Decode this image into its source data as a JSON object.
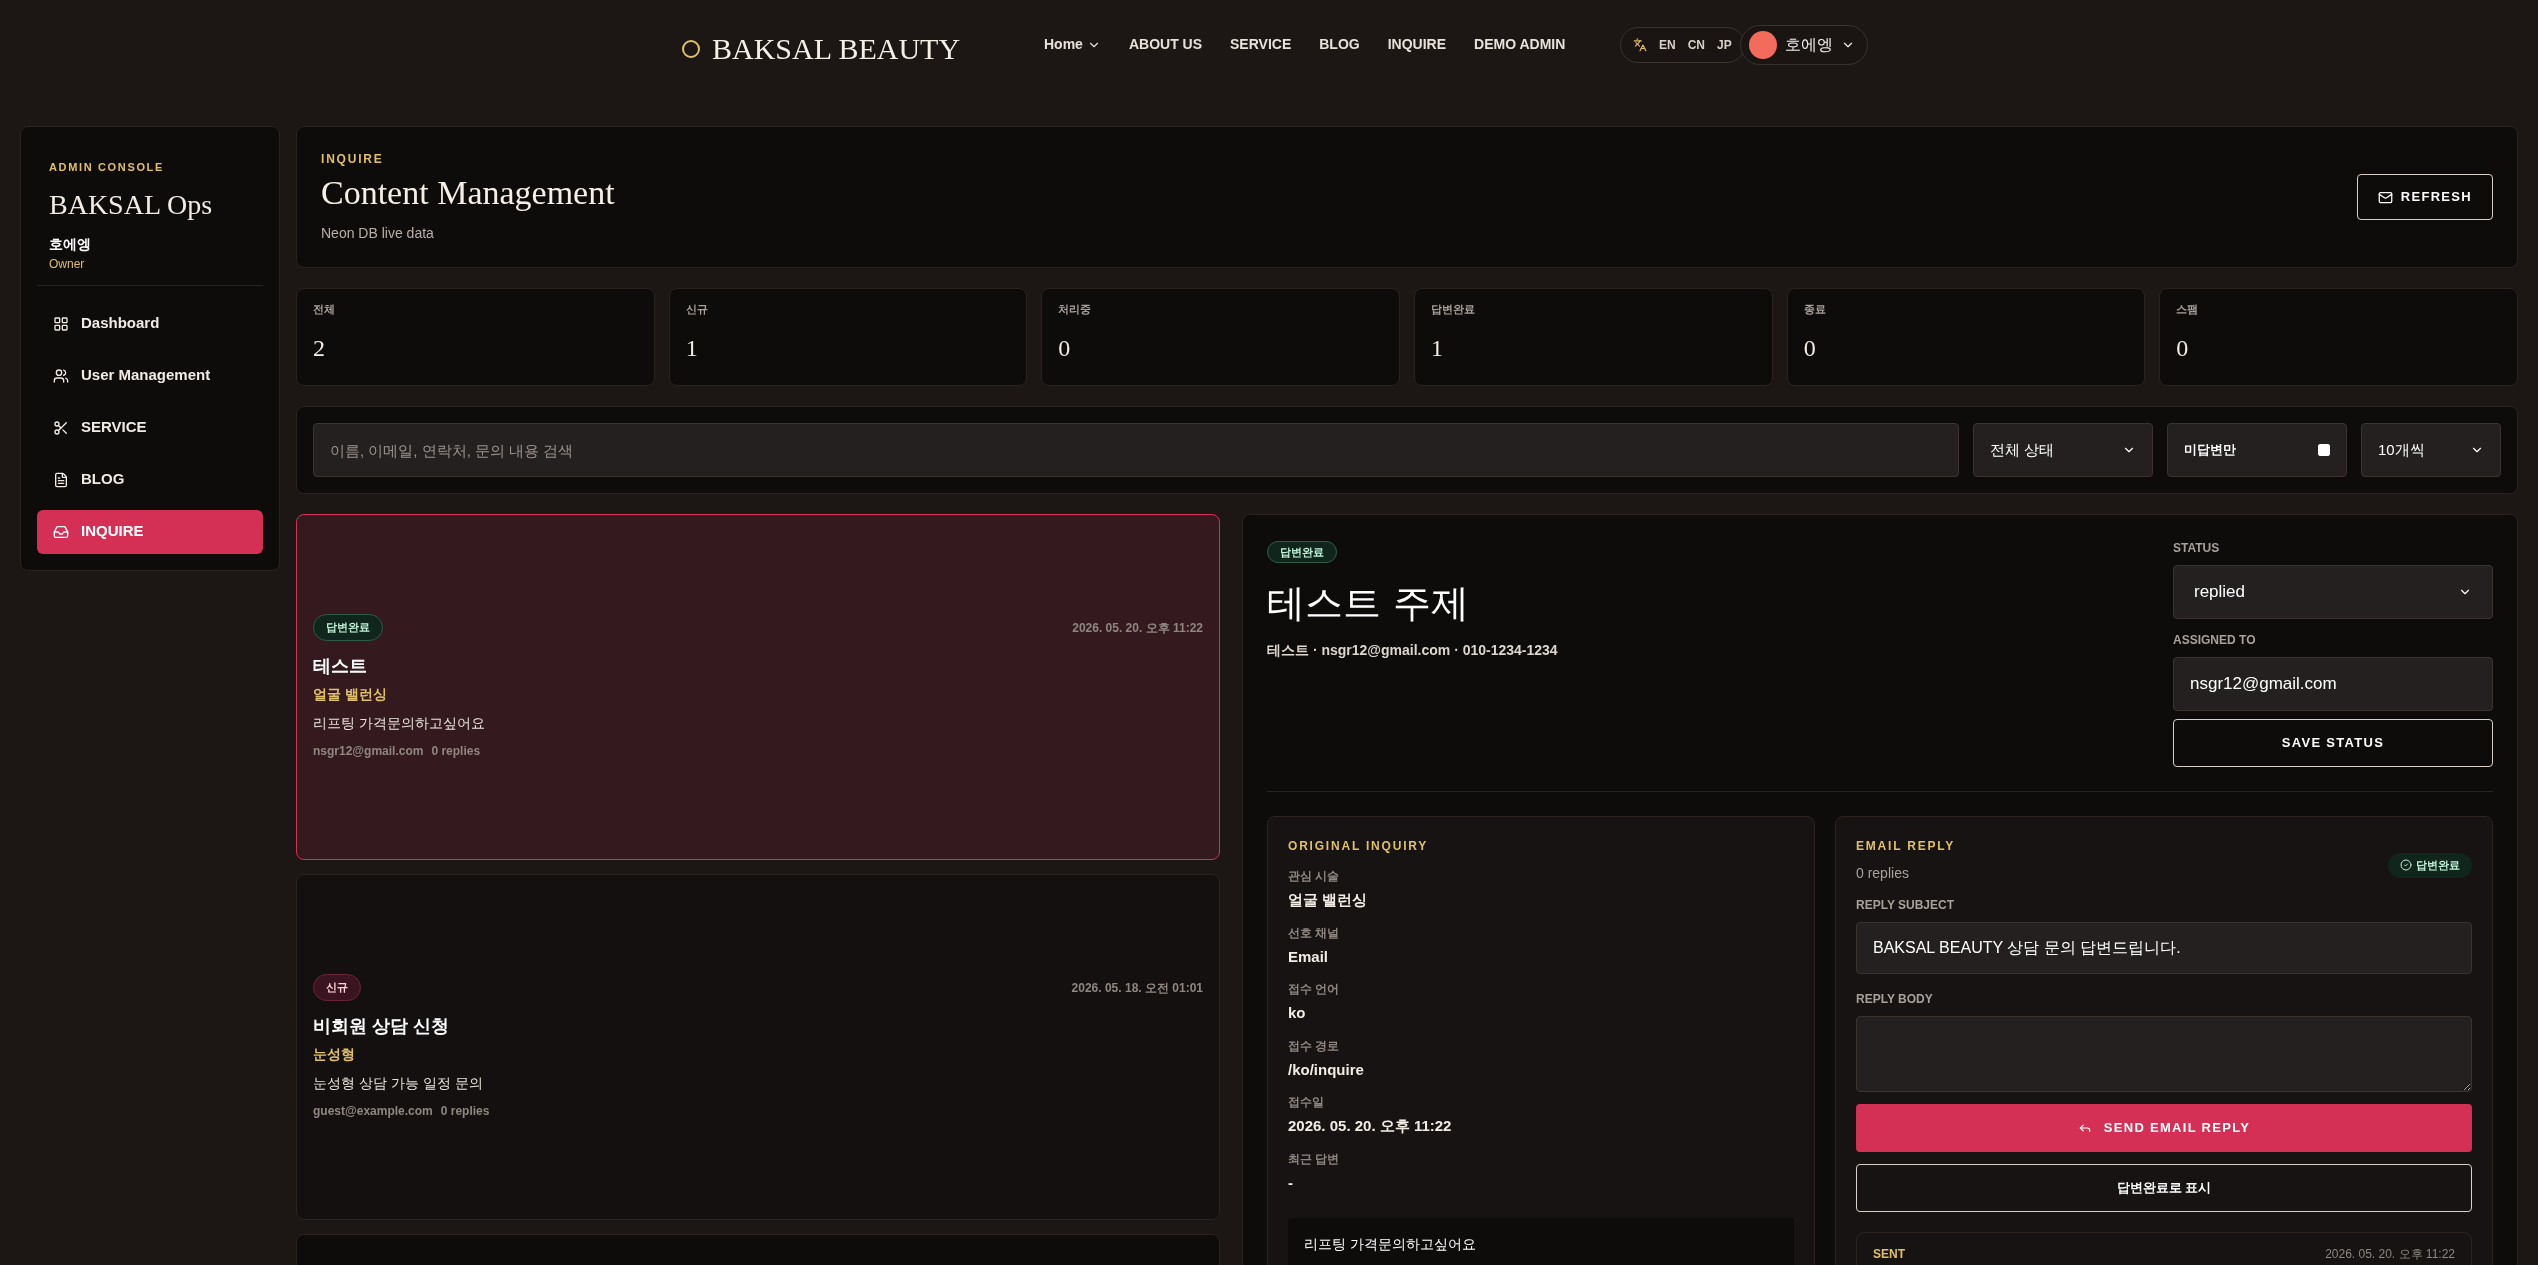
{
  "header": {
    "logo": "BAKSAL BEAUTY",
    "nav": [
      {
        "label": "Home",
        "dropdown": true
      },
      {
        "label": "ABOUT US",
        "dropdown": false
      },
      {
        "label": "SERVICE",
        "dropdown": false
      },
      {
        "label": "BLOG",
        "dropdown": false
      },
      {
        "label": "INQUIRE",
        "dropdown": false
      },
      {
        "label": "DEMO ADMIN",
        "dropdown": false
      }
    ],
    "languages": [
      "EN",
      "CN",
      "JP"
    ],
    "user": {
      "name": "호에엥"
    }
  },
  "sidebar": {
    "eyebrow": "ADMIN CONSOLE",
    "title": "BAKSAL Ops",
    "user_name": "호에엥",
    "role": "Owner",
    "items": [
      {
        "label": "Dashboard",
        "selected": false
      },
      {
        "label": "User Management",
        "selected": false
      },
      {
        "label": "SERVICE",
        "selected": false
      },
      {
        "label": "BLOG",
        "selected": false
      },
      {
        "label": "INQUIRE",
        "selected": true
      }
    ]
  },
  "page_header": {
    "eyebrow": "INQUIRE",
    "title": "Content Management",
    "subtitle": "Neon DB live data",
    "refresh_button": "REFRESH"
  },
  "stats": [
    {
      "label": "전체",
      "value": "2"
    },
    {
      "label": "신규",
      "value": "1"
    },
    {
      "label": "처리중",
      "value": "0"
    },
    {
      "label": "답변완료",
      "value": "1"
    },
    {
      "label": "종료",
      "value": "0"
    },
    {
      "label": "스팸",
      "value": "0"
    }
  ],
  "filters": {
    "search_placeholder": "이름, 이메일, 연락처, 문의 내용 검색",
    "status_select": "전체 상태",
    "unanswered_only": {
      "label": "미답변만",
      "checked": false
    },
    "page_size": "10개씩"
  },
  "inquiries": [
    {
      "badge": "답변완료",
      "kind": "replied",
      "date": "2026. 05. 20. 오후 11:22",
      "name": "테스트",
      "treatment": "얼굴 밸런싱",
      "message": "리프팅 가격문의하고싶어요",
      "email": "nsgr12@gmail.com",
      "replies": "0 replies",
      "selected": true
    },
    {
      "badge": "신규",
      "kind": "new",
      "date": "2026. 05. 18. 오전 01:01",
      "name": "비회원 상담 신청",
      "treatment": "눈성형",
      "message": "눈성형 상담 가능 일정 문의",
      "email": "guest@example.com",
      "replies": "0 replies",
      "selected": false
    }
  ],
  "detail": {
    "badge": "답변완료",
    "kind": "replied",
    "title": "테스트 주제",
    "meta": "테스트 · nsgr12@gmail.com · 010-1234-1234",
    "status_label": "STATUS",
    "status_value": "replied",
    "assigned_label": "ASSIGNED TO",
    "assigned_value": "nsgr12@gmail.com",
    "save_button": "SAVE STATUS",
    "original": {
      "heading": "ORIGINAL INQUIRY",
      "fields": [
        {
          "label": "관심 시술",
          "value": "얼굴 밸런싱"
        },
        {
          "label": "선호 채널",
          "value": "Email"
        },
        {
          "label": "접수 언어",
          "value": "ko"
        },
        {
          "label": "접수 경로",
          "value": "/ko/inquire"
        },
        {
          "label": "접수일",
          "value": "2026. 05. 20. 오후 11:22"
        },
        {
          "label": "최근 답변",
          "value": "-"
        }
      ],
      "message": "리프팅 가격문의하고싶어요"
    },
    "reply": {
      "heading": "EMAIL REPLY",
      "count": "0 replies",
      "badge": "답변완료",
      "subject_label": "REPLY SUBJECT",
      "subject_value": "BAKSAL BEAUTY 상담 문의 답변드립니다.",
      "body_label": "REPLY BODY",
      "send_button": "SEND EMAIL REPLY",
      "mark_button": "답변완료로 표시",
      "sent_label": "SENT",
      "sent_date": "2026. 05. 20. 오후 11:22"
    }
  }
}
